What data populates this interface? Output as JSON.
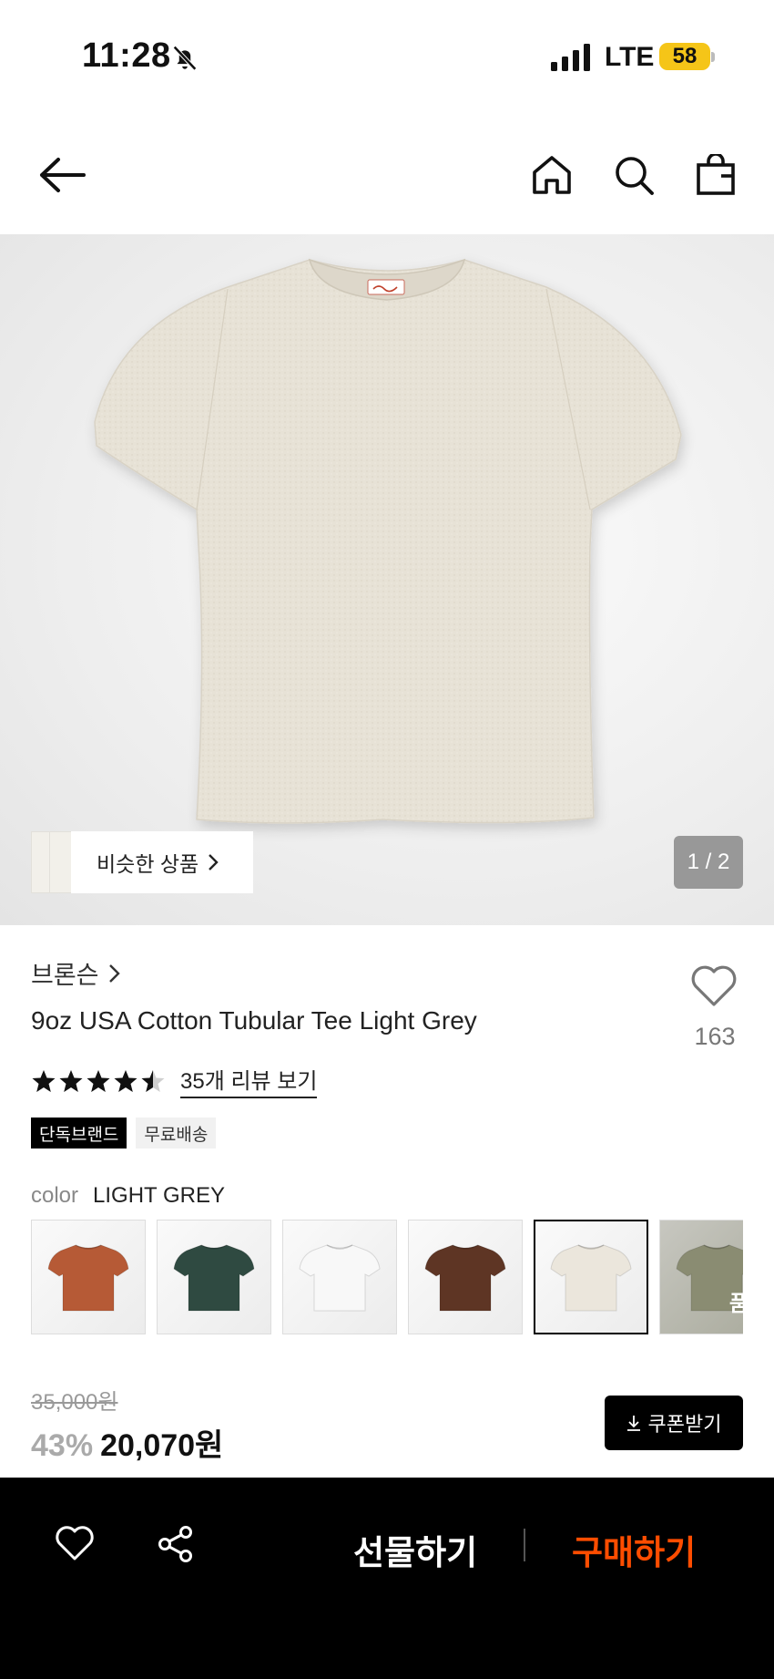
{
  "status_bar": {
    "time": "11:28",
    "network": "LTE",
    "battery": "58"
  },
  "hero": {
    "similar_label": "비슷한 상품",
    "counter": "1 / 2"
  },
  "product": {
    "brand": "브론슨",
    "title": "9oz USA Cotton Tubular Tee Light Grey",
    "like_count": "163",
    "rating": 4.5,
    "review_link": "35개 리뷰 보기",
    "badges": [
      "단독브랜드",
      "무료배송"
    ],
    "color_label": "color",
    "color_value": "LIGHT GREY",
    "swatches": [
      {
        "color": "#b65a36",
        "selected": false,
        "soldout": ""
      },
      {
        "color": "#2f4a41",
        "selected": false,
        "soldout": ""
      },
      {
        "color": "#f8f8f8",
        "selected": false,
        "soldout": ""
      },
      {
        "color": "#5e3524",
        "selected": false,
        "soldout": ""
      },
      {
        "color": "#ebe6dc",
        "selected": true,
        "soldout": ""
      },
      {
        "color": "#8a8c72",
        "selected": false,
        "soldout": "품절"
      }
    ]
  },
  "price": {
    "original": "35,000원",
    "discount": "43%",
    "sale": "20,070원",
    "coupon_label": "쿠폰받기"
  },
  "bottom_bar": {
    "gift_label": "선물하기",
    "buy_label": "구매하기"
  },
  "colors": {
    "buy_accent": "#ff4d00",
    "battery": "#f5c518"
  }
}
